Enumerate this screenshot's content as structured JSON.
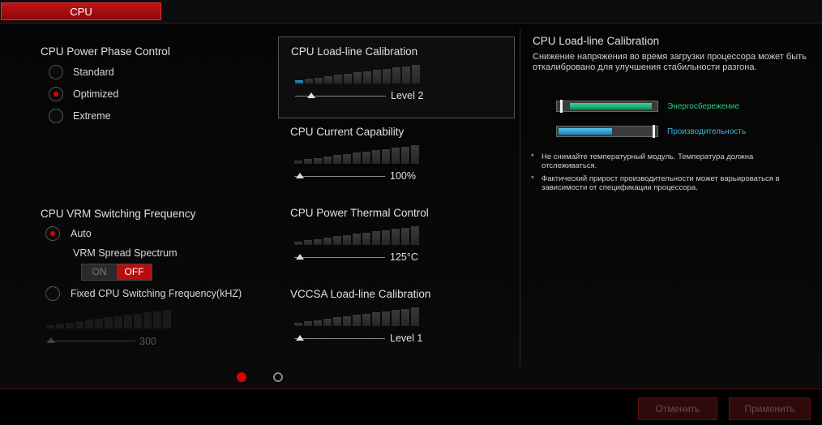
{
  "tab": {
    "label": "CPU"
  },
  "phase_control": {
    "title": "CPU Power Phase Control",
    "options": [
      "Standard",
      "Optimized",
      "Extreme"
    ],
    "selected": "Optimized"
  },
  "vrm": {
    "title": "CPU VRM Switching Frequency",
    "auto_label": "Auto",
    "spread_label": "VRM Spread Spectrum",
    "toggle_on": "ON",
    "toggle_off": "OFF",
    "toggle_state": "OFF",
    "fixed_label": "Fixed CPU Switching Frequency(kHZ)",
    "fixed_value": "300",
    "selected": "Auto"
  },
  "sliders": [
    {
      "title": "CPU Load-line Calibration",
      "value": "Level 2"
    },
    {
      "title": "CPU Current Capability",
      "value": "100%"
    },
    {
      "title": "CPU Power Thermal Control",
      "value": "125°C"
    },
    {
      "title": "VCCSA Load-line Calibration",
      "value": "Level 1"
    }
  ],
  "info": {
    "title": "CPU Load-line Calibration",
    "description": "Снижение напряжения во время загрузки процессора может быть откалибровано для улучшения стабильности разгона.",
    "bar_energy_label": "Энергосбережение",
    "bar_energy_fill": 0.95,
    "bar_perf_label": "Производительность",
    "bar_perf_fill": 0.6,
    "note1": "Не снимайте температурный модуль. Температура должна отслеживаться.",
    "note2": "Фактический прирост производительности может варьироваться в зависимости от спецификации процессора.",
    "star": "*"
  },
  "pager": {
    "pages": 2,
    "current": 1
  },
  "footer": {
    "cancel_label": "Отменить",
    "apply_label": "Применить"
  },
  "colors": {
    "accent": "#c01515",
    "energy": "#1fbf7a",
    "performance": "#2aa6d8"
  }
}
